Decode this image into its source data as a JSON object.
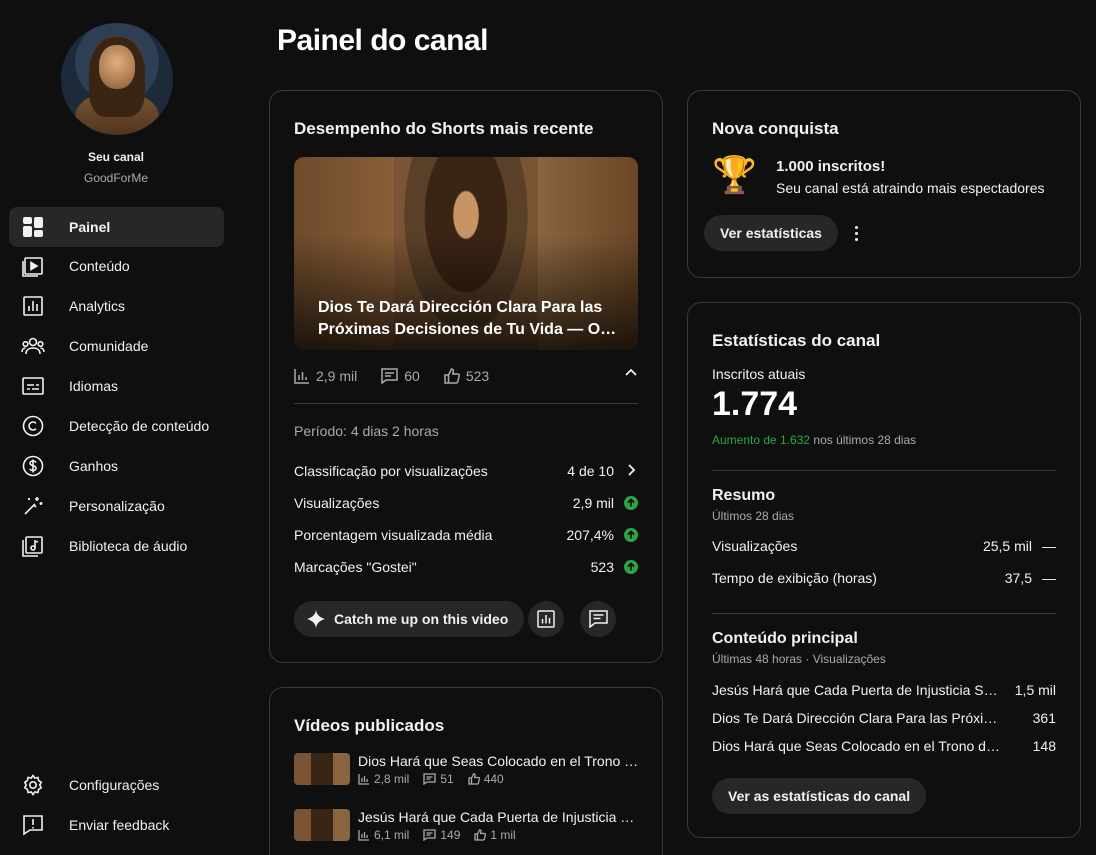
{
  "sidebar": {
    "channel_label": "Seu canal",
    "channel_name": "GoodForMe",
    "items": [
      {
        "label": "Painel"
      },
      {
        "label": "Conteúdo"
      },
      {
        "label": "Analytics"
      },
      {
        "label": "Comunidade"
      },
      {
        "label": "Idiomas"
      },
      {
        "label": "Detecção de conteúdo"
      },
      {
        "label": "Ganhos"
      },
      {
        "label": "Personalização"
      },
      {
        "label": "Biblioteca de áudio"
      }
    ],
    "bottom": [
      {
        "label": "Configurações"
      },
      {
        "label": "Enviar feedback"
      }
    ]
  },
  "page_title": "Painel do canal",
  "shorts": {
    "heading": "Desempenho do Shorts mais recente",
    "title_line1": "Dios Te Dará Dirección Clara Para las",
    "title_line2": "Próximas Decisiones de Tu Vida — Ora...",
    "views": "2,9 mil",
    "comments": "60",
    "likes": "523",
    "period": "Período: 4 dias 2 horas",
    "metrics": [
      {
        "name": "Classificação por visualizações",
        "value": "4 de 10"
      },
      {
        "name": "Visualizações",
        "value": "2,9 mil"
      },
      {
        "name": "Porcentagem visualizada média",
        "value": "207,4%"
      },
      {
        "name": "Marcações \"Gostei\"",
        "value": "523"
      }
    ],
    "catch_label": "Catch me up on this video"
  },
  "videos": {
    "heading": "Vídeos publicados",
    "items": [
      {
        "title": "Dios Hará que Seas Colocado en el Trono de Honor",
        "views": "2,8 mil",
        "comments": "51",
        "likes": "440"
      },
      {
        "title": "Jesús Hará que Cada Puerta de Injusticia Se Cierre",
        "views": "6,1 mil",
        "comments": "149",
        "likes": "1 mil"
      }
    ]
  },
  "achievement": {
    "heading": "Nova conquista",
    "title": "1.000 inscritos!",
    "subtitle": "Seu canal está atraindo mais espectadores",
    "button": "Ver estatísticas"
  },
  "channel_stats": {
    "heading": "Estatísticas do canal",
    "subs_label": "Inscritos atuais",
    "subs_value": "1.774",
    "growth_prefix": "Aumento de 1.632",
    "growth_suffix": " nos últimos 28 dias",
    "summary_title": "Resumo",
    "summary_sub": "Últimos 28 dias",
    "summary": [
      {
        "name": "Visualizações",
        "value": "25,5 mil",
        "change": "—"
      },
      {
        "name": "Tempo de exibição (horas)",
        "value": "37,5",
        "change": "—"
      }
    ],
    "top_title": "Conteúdo principal",
    "top_sub": "Últimas 48 horas · Visualizações",
    "top": [
      {
        "name": "Jesús Hará que Cada Puerta de Injusticia Se Cierre",
        "value": "1,5 mil"
      },
      {
        "name": "Dios Te Dará Dirección Clara Para las Próximas Decisiones",
        "value": "361"
      },
      {
        "name": "Dios Hará que Seas Colocado en el Trono de Honor",
        "value": "148"
      }
    ],
    "button": "Ver as estatísticas do canal"
  },
  "colors": {
    "accent_green": "#2ba640",
    "bg": "#0f0f0f",
    "card_border": "#3a3a3a"
  }
}
